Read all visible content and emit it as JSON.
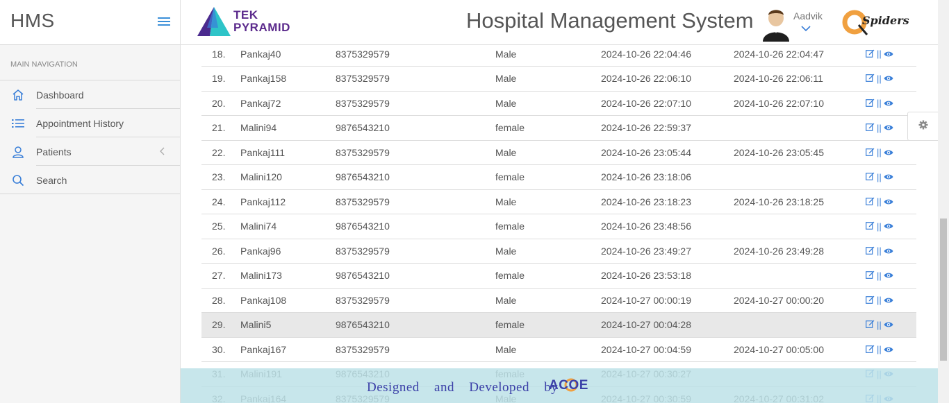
{
  "brand": {
    "name": "HMS"
  },
  "sidebar": {
    "header": "MAIN NAVIGATION",
    "items": [
      {
        "label": "Dashboard",
        "icon": "home-icon"
      },
      {
        "label": "Appointment History",
        "icon": "list-icon"
      },
      {
        "label": "Patients",
        "icon": "user-icon"
      },
      {
        "label": "Search",
        "icon": "search-icon"
      }
    ]
  },
  "header": {
    "logo_line1": "TEK",
    "logo_line2": "PYRAMID",
    "title": "Hospital Management System",
    "user": "Aadvik",
    "partner_logo": "Spiders"
  },
  "table": {
    "rows": [
      {
        "no": "18.",
        "name": "Pankaj40",
        "phone": "8375329579",
        "gender": "Male",
        "created": "2024-10-26 22:04:46",
        "updated": "2024-10-26 22:04:47"
      },
      {
        "no": "19.",
        "name": "Pankaj158",
        "phone": "8375329579",
        "gender": "Male",
        "created": "2024-10-26 22:06:10",
        "updated": "2024-10-26 22:06:11"
      },
      {
        "no": "20.",
        "name": "Pankaj72",
        "phone": "8375329579",
        "gender": "Male",
        "created": "2024-10-26 22:07:10",
        "updated": "2024-10-26 22:07:10"
      },
      {
        "no": "21.",
        "name": "Malini94",
        "phone": "9876543210",
        "gender": "female",
        "created": "2024-10-26 22:59:37",
        "updated": ""
      },
      {
        "no": "22.",
        "name": "Pankaj111",
        "phone": "8375329579",
        "gender": "Male",
        "created": "2024-10-26 23:05:44",
        "updated": "2024-10-26 23:05:45"
      },
      {
        "no": "23.",
        "name": "Malini120",
        "phone": "9876543210",
        "gender": "female",
        "created": "2024-10-26 23:18:06",
        "updated": ""
      },
      {
        "no": "24.",
        "name": "Pankaj112",
        "phone": "8375329579",
        "gender": "Male",
        "created": "2024-10-26 23:18:23",
        "updated": "2024-10-26 23:18:25"
      },
      {
        "no": "25.",
        "name": "Malini74",
        "phone": "9876543210",
        "gender": "female",
        "created": "2024-10-26 23:48:56",
        "updated": ""
      },
      {
        "no": "26.",
        "name": "Pankaj96",
        "phone": "8375329579",
        "gender": "Male",
        "created": "2024-10-26 23:49:27",
        "updated": "2024-10-26 23:49:28"
      },
      {
        "no": "27.",
        "name": "Malini173",
        "phone": "9876543210",
        "gender": "female",
        "created": "2024-10-26 23:53:18",
        "updated": ""
      },
      {
        "no": "28.",
        "name": "Pankaj108",
        "phone": "8375329579",
        "gender": "Male",
        "created": "2024-10-27 00:00:19",
        "updated": "2024-10-27 00:00:20"
      },
      {
        "no": "29.",
        "name": "Malini5",
        "phone": "9876543210",
        "gender": "female",
        "created": "2024-10-27 00:04:28",
        "updated": "",
        "highlight": true
      },
      {
        "no": "30.",
        "name": "Pankaj167",
        "phone": "8375329579",
        "gender": "Male",
        "created": "2024-10-27 00:04:59",
        "updated": "2024-10-27 00:05:00"
      },
      {
        "no": "31.",
        "name": "Malini191",
        "phone": "9876543210",
        "gender": "female",
        "created": "2024-10-27 00:30:27",
        "updated": ""
      },
      {
        "no": "32.",
        "name": "Pankaj164",
        "phone": "8375329579",
        "gender": "Male",
        "created": "2024-10-27 00:30:59",
        "updated": "2024-10-27 00:31:02"
      }
    ],
    "action_separator": "||"
  },
  "footer": {
    "text": "Designed and Developed by",
    "logo": "ACOE"
  },
  "colors": {
    "accent": "#3a7fd8",
    "footer_bg": "#bde2e8",
    "footer_text": "#3b40a8"
  }
}
